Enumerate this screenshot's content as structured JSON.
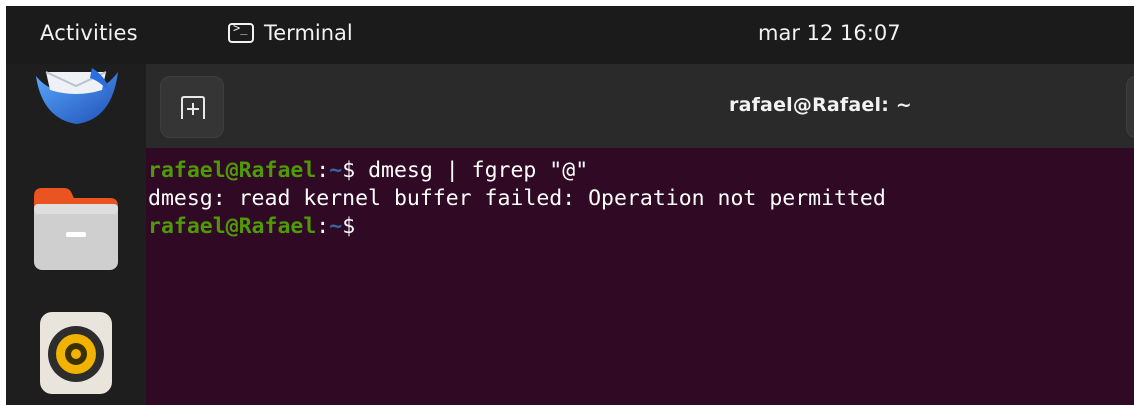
{
  "topbar": {
    "activities": "Activities",
    "app_name": "Terminal",
    "app_icon_glyph": ">_",
    "clock": "mar 12  16:07"
  },
  "dock": {
    "items": [
      {
        "name": "mail-app",
        "icon": "envelope-bird-icon"
      },
      {
        "name": "files-app",
        "icon": "folder-icon"
      },
      {
        "name": "rhythmbox-app",
        "icon": "speaker-icon"
      }
    ]
  },
  "terminal": {
    "title": "rafael@Rafael: ~",
    "new_tab_icon": "new-tab-icon",
    "lines": [
      {
        "user": "rafael@Rafael",
        "sep": ":",
        "path": "~",
        "dollar": "$",
        "command": " dmesg | fgrep \"@\""
      },
      {
        "output": "dmesg: read kernel buffer failed: Operation not permitted"
      },
      {
        "user": "rafael@Rafael",
        "sep": ":",
        "path": "~",
        "dollar": "$",
        "command": ""
      }
    ]
  },
  "colors": {
    "terminal_bg": "#300a24",
    "prompt_user": "#4e9a06",
    "prompt_path": "#3465a4",
    "topbar_bg": "#1b1b1b"
  }
}
